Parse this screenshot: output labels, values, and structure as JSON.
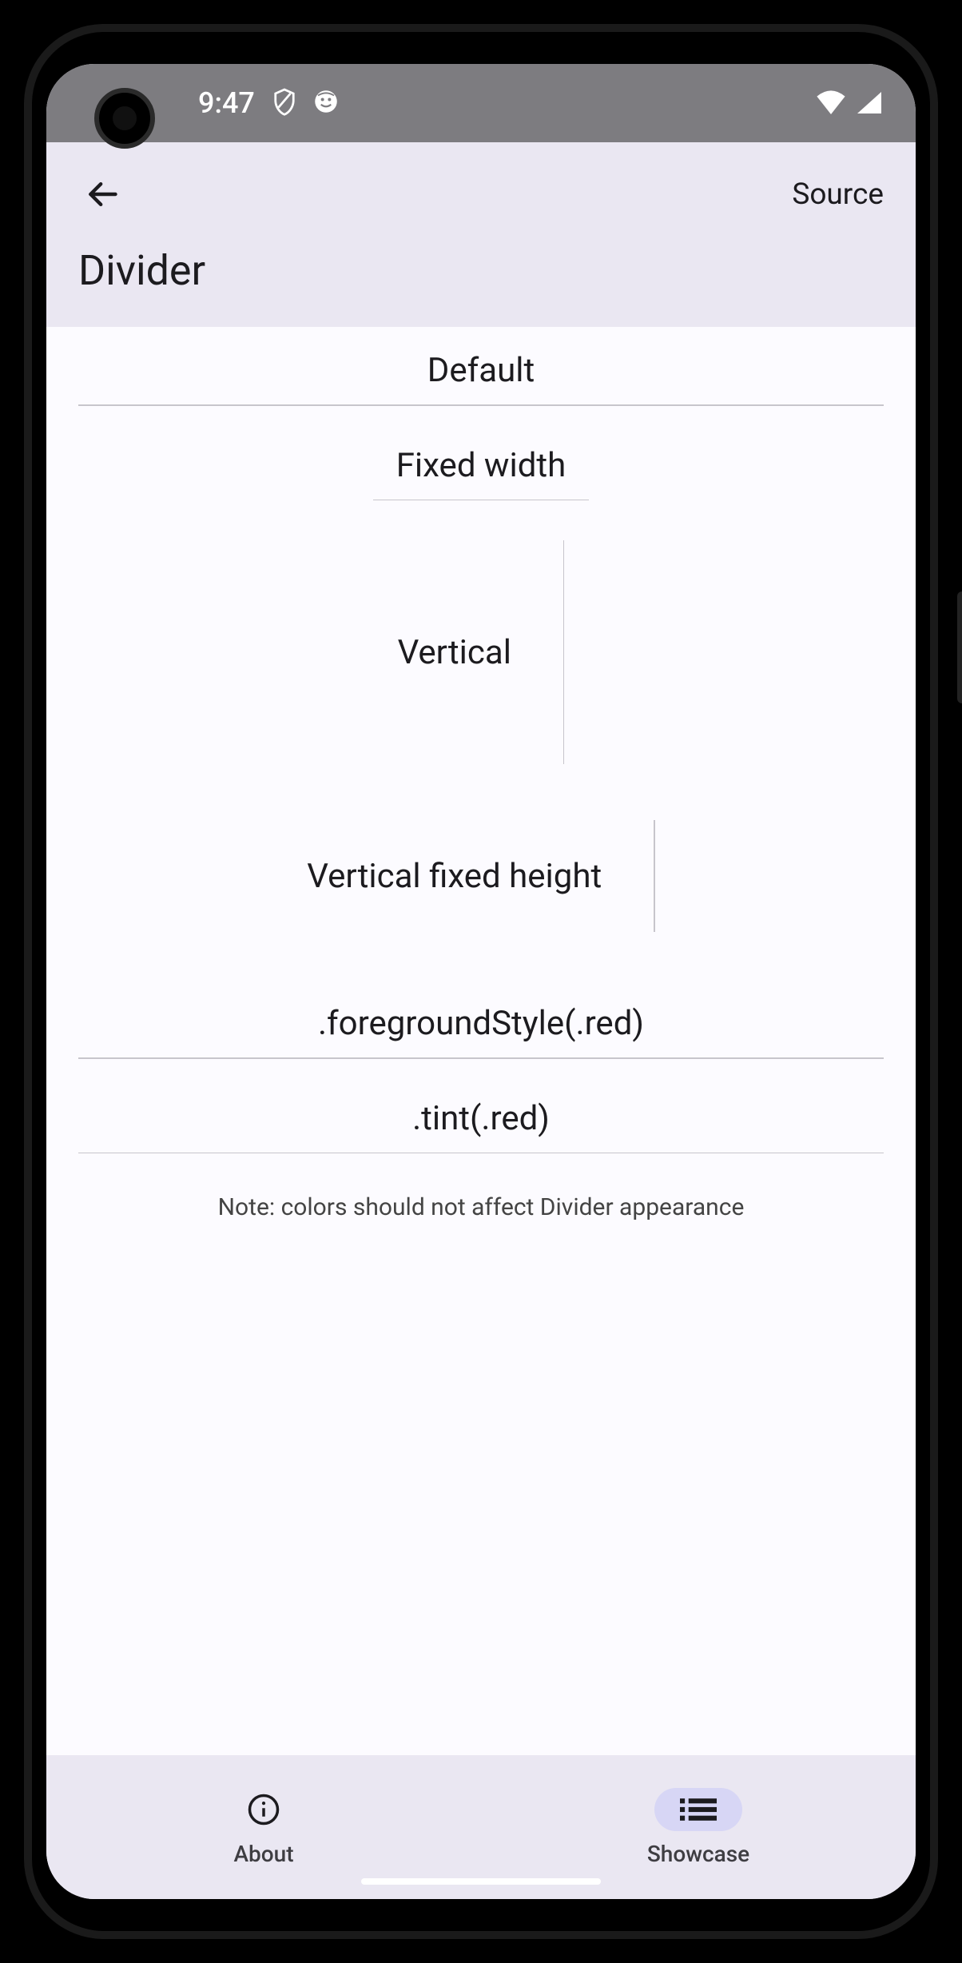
{
  "status": {
    "time": "9:47"
  },
  "header": {
    "source_label": "Source",
    "title": "Divider"
  },
  "sections": {
    "default": "Default",
    "fixed_width": "Fixed width",
    "vertical": "Vertical",
    "vertical_fixed": "Vertical fixed height",
    "foreground": ".foregroundStyle(.red)",
    "tint": ".tint(.red)",
    "note": "Note: colors should not affect Divider appearance"
  },
  "nav": {
    "about": "About",
    "showcase": "Showcase"
  }
}
